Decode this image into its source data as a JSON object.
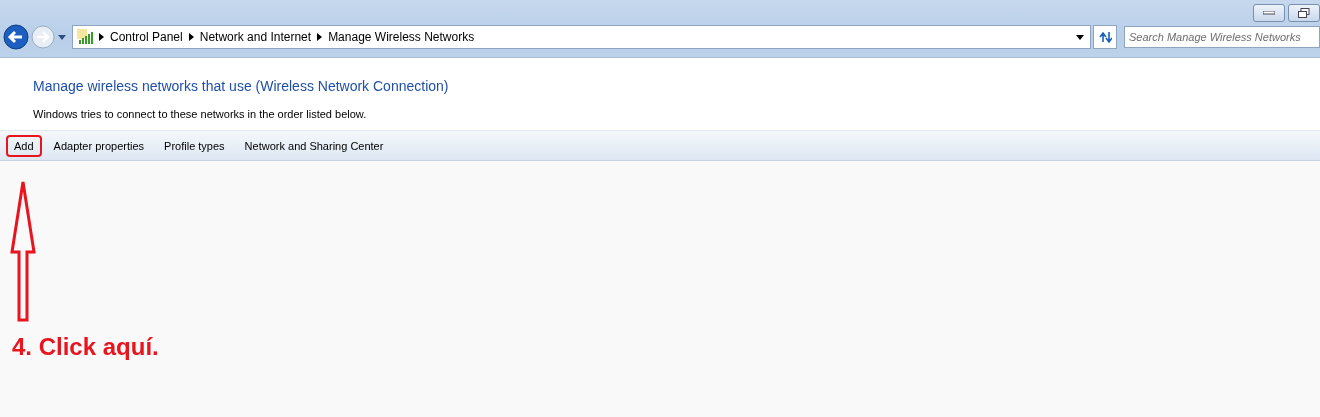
{
  "breadcrumb": [
    "Control Panel",
    "Network and Internet",
    "Manage Wireless Networks"
  ],
  "search": {
    "placeholder": "Search Manage Wireless Networks"
  },
  "heading": "Manage wireless networks that use (Wireless Network Connection)",
  "description": "Windows tries to connect to these networks in the order listed below.",
  "toolbar": [
    {
      "label": "Add",
      "highlighted": true
    },
    {
      "label": "Adapter properties",
      "highlighted": false
    },
    {
      "label": "Profile types",
      "highlighted": false
    },
    {
      "label": "Network and Sharing Center",
      "highlighted": false
    }
  ],
  "annotation": "4. Click aquí."
}
